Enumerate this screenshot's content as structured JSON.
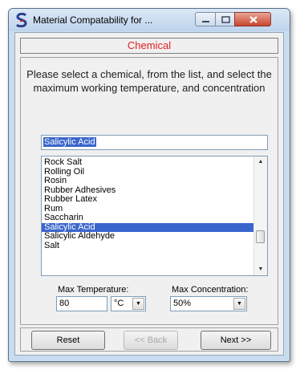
{
  "window": {
    "title": "Material Compatability for ...",
    "accent": "#e02020"
  },
  "header": {
    "label": "Chemical"
  },
  "instructions": "Please select a chemical, from the list, and select the maximum working temperature, and concentration",
  "search": {
    "value": "Salicylic Acid"
  },
  "chemical_list": {
    "items": [
      "Rock Salt",
      "Rolling Oil",
      "Rosin",
      "Rubber Adhesives",
      "Rubber Latex",
      "Rum",
      "Saccharin",
      "Salicylic Acid",
      "Salicylic Aldehyde",
      "Salt"
    ],
    "selected": "Salicylic Acid"
  },
  "max_temperature": {
    "label": "Max Temperature:",
    "value": "80",
    "unit": "°C"
  },
  "max_concentration": {
    "label": "Max Concentration:",
    "value": "50%"
  },
  "buttons": {
    "reset": "Reset",
    "back": "<< Back",
    "next": "Next >>"
  }
}
